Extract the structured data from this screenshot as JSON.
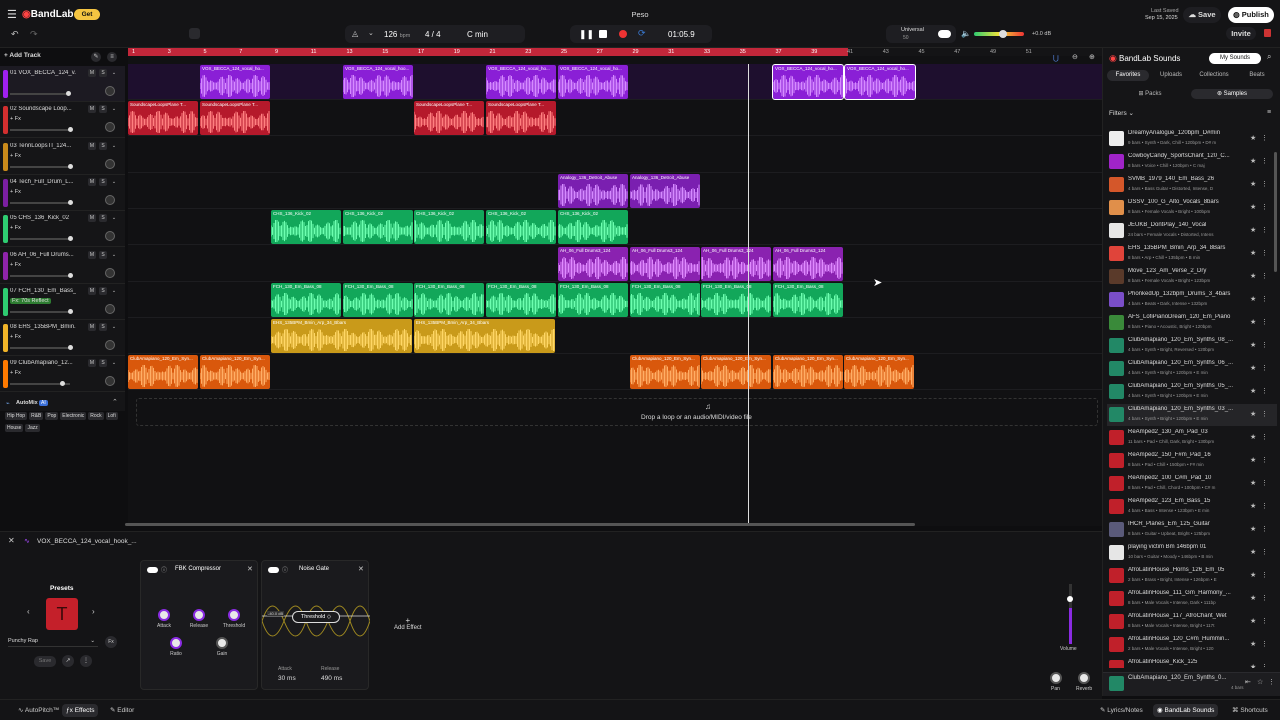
{
  "topbar": {
    "logo": "BandLab",
    "get": "Get",
    "title": "Peso",
    "bpm": "126",
    "bpm_unit": "bpm",
    "sig": "4 / 4",
    "key": "C min",
    "time": "01:05.9",
    "universal": "Universal",
    "universal_val": "50",
    "db": "+0.0 dB",
    "last_saved": "Last Saved",
    "saved_date": "Sep 15, 2025",
    "save": "Save",
    "publish": "Publish",
    "invite": "Invite",
    "add_track": "Add Track"
  },
  "tracks": [
    {
      "name": "01 VOX_BECCA_124_v...",
      "fx": "",
      "color": "#a020f0"
    },
    {
      "name": "02 Soundscape Loop...",
      "fx": "+ Fx",
      "color": "#d32f2f"
    },
    {
      "name": "03 TennLoopsTI_124...",
      "fx": "+ Fx",
      "color": "#c98a1b"
    },
    {
      "name": "04 Tech_Full_Drum_L...",
      "fx": "+ Fx",
      "color": "#7b1fa2"
    },
    {
      "name": "05 CHS_136_Kick_02",
      "fx": "+ Fx",
      "color": "#2ecc71"
    },
    {
      "name": "06 AH_06_Full Drums...",
      "fx": "+ Fx",
      "color": "#8e24aa"
    },
    {
      "name": "07 FCH_130_Em_Bass_...",
      "fx": "Fx: 70s Reflect",
      "color": "#2ecc71"
    },
    {
      "name": "08 EHS_135BPM_Bmin...",
      "fx": "+ Fx",
      "color": "#f0b429"
    },
    {
      "name": "09 ClubAmapiano_12...",
      "fx": "+ Fx",
      "color": "#ff7a00"
    }
  ],
  "ruler": [
    "1",
    "3",
    "5",
    "7",
    "9",
    "11",
    "13",
    "15",
    "17",
    "19",
    "21",
    "23",
    "25",
    "27",
    "29",
    "31",
    "33",
    "35",
    "37",
    "39",
    "41",
    "43",
    "45",
    "47",
    "49",
    "51"
  ],
  "clips": [
    {
      "lane": 0,
      "color": "#8a1fd6",
      "wave": "#d58bff",
      "labels": [
        "VOX_BECCA_124_vocal_ho...",
        "VOX_BECCA_124_vocal_hoo...",
        "VOX_BECCA_124_vocal_ho...",
        "VOX_BECCA_124_vocal_ho...",
        "VOX_BECCA_124_vocal_ho...",
        "VOX_BECCA_124_vocal_ho..."
      ],
      "starts": [
        72,
        215,
        358,
        430,
        645,
        717
      ],
      "width": 71
    },
    {
      "lane": 1,
      "color": "#b5192b",
      "wave": "#ff8080",
      "labels": [
        "SoundscapeLoopsPlane T...",
        "SoundscapeLoopsPlane T...",
        "SoundscapeLoopsPlane T...",
        "SoundscapeLoopsPlane T..."
      ],
      "starts": [
        0,
        72,
        286,
        358
      ],
      "width": 71
    },
    {
      "lane": 3,
      "color": "#7a1fb0",
      "wave": "#d58bff",
      "labels": [
        "Analogy_136_Detroit_Abuse",
        "Analogy_136_Detroit_Abuse"
      ],
      "starts": [
        430,
        502
      ],
      "width": 71
    },
    {
      "lane": 4,
      "color": "#12a75a",
      "wave": "#6dffb0",
      "labels": [
        "CHS_136_Kick_02",
        "CHS_136_Kick_02",
        "CHS_136_Kick_02",
        "CHS_136_Kick_02",
        "CHS_136_Kick_02"
      ],
      "starts": [
        143,
        215,
        286,
        358,
        430
      ],
      "width": 71
    },
    {
      "lane": 5,
      "color": "#8a22b0",
      "wave": "#e08bff",
      "labels": [
        "AH_06_Full Drums3_124",
        "AH_06_Full Drums3_124",
        "AH_06_Full Drums3_124",
        "AH_06_Full Drums3_124"
      ],
      "starts": [
        430,
        502,
        573,
        645
      ],
      "width": 71
    },
    {
      "lane": 6,
      "color": "#12a75a",
      "wave": "#6dffb0",
      "labels": [
        "FCH_130_Em_Bass_08",
        "FCH_130_Em_Bass_08",
        "FCH_130_Em_Bass_08",
        "FCH_130_Em_Bass_08",
        "FCH_130_Em_Bass_08",
        "FCH_130_Em_Bass_08",
        "FCH_130_Em_Bass_08",
        "FCH_130_Em_Bass_08"
      ],
      "starts": [
        143,
        215,
        286,
        358,
        430,
        502,
        573,
        645
      ],
      "width": 71
    },
    {
      "lane": 7,
      "color": "#c99a1a",
      "wave": "#ffd766",
      "labels": [
        "EHS_135BPM_Bmin_Arp_34_Bbars",
        "EHS_135BPM_Bmin_Arp_34_Bbars"
      ],
      "starts": [
        143,
        286
      ],
      "width": 142
    },
    {
      "lane": 8,
      "color": "#d9580c",
      "wave": "#ffae66",
      "labels": [
        "ClubAmapiano_120_Em_Syn...",
        "ClubAmapiano_120_Em_Syn...",
        "ClubAmapiano_120_Em_Syn...",
        "ClubAmapiano_120_Em_Syn...",
        "ClubAmapiano_120_Em_Syn...",
        "ClubAmapiano_120_Em_Syn..."
      ],
      "starts": [
        0,
        72,
        502,
        573,
        645,
        716
      ],
      "width": 71
    }
  ],
  "drop_text": "Drop a loop or an audio/MIDI/video file",
  "genres": {
    "title": "AutoMix",
    "badge": "AI",
    "tags": [
      "Hip Hop",
      "R&B",
      "Pop",
      "Electronic",
      "Rock",
      "Lofi",
      "House",
      "Jazz"
    ]
  },
  "sounds": {
    "title": "BandLab Sounds",
    "my_sounds": "My Sounds",
    "tabs": [
      "Favorites",
      "Uploads",
      "Collections",
      "Beats"
    ],
    "subtabs": [
      "Packs",
      "Samples"
    ],
    "filters": "Filters",
    "items": [
      {
        "name": "DreamyAnalogue_120bpm_D#min",
        "meta": "9 bars • Synth • Dark, Chill • 120bpm • D# m",
        "color": "#eee"
      },
      {
        "name": "CowboyCandy_SportsChant_120_C...",
        "meta": "8 bars • Voice • Chill • 120bpm • C maj",
        "color": "#a024c8"
      },
      {
        "name": "SVMB_1979_140_Em_Bass_26",
        "meta": "4 bars • Bass Guitar • Distorted, Intense, D",
        "color": "#d4572a"
      },
      {
        "name": "DSSV_100_G_Alto_Vocals_8bars",
        "meta": "8 bars • Female Vocals • Bright • 100bpm",
        "color": "#e08f4a"
      },
      {
        "name": "JEUKB_DontPlay_140_Vocal",
        "meta": "24 bars • Female Vocals • Distorted, Intens",
        "color": "#e6e6e6"
      },
      {
        "name": "EHS_135BPM_Bmin_Arp_34_8Bars",
        "meta": "8 bars • Arp • Chill • 135bpm • B min",
        "color": "#e0443a"
      },
      {
        "name": "Move_123_Am_Verse_2_Dry",
        "meta": "8 bars • Female Vocals • Bright • 123bpm",
        "color": "#5a3a2a"
      },
      {
        "name": "PhonkedUp_132bpm_Drums_3_4bars",
        "meta": "4 bars • Beats • Dark, Intense • 132bpm",
        "color": "#7a4ec8"
      },
      {
        "name": "AFS_LofiPianoDream_120_Em_Piano",
        "meta": "8 bars • Piano • Acoustic, Bright • 120bpm",
        "color": "#3a8a3a"
      },
      {
        "name": "ClubAmapiano_120_Em_Synths_08_...",
        "meta": "4 bars • Synth • Bright, Reversed • 120bpm",
        "color": "#228866"
      },
      {
        "name": "ClubAmapiano_120_Em_Synths_06_...",
        "meta": "4 bars • Synth • Bright • 120bpm • E min",
        "color": "#228866"
      },
      {
        "name": "ClubAmapiano_120_Em_Synths_05_...",
        "meta": "4 bars • Synth • Bright • 120bpm • E min",
        "color": "#228866"
      },
      {
        "name": "ClubAmapiano_120_Em_Synths_03_...",
        "meta": "4 bars • Synth • Bright • 120bpm • E min",
        "color": "#228866"
      },
      {
        "name": "ReAmped2_130_Am_Pad_03",
        "meta": "11 bars • Pad • Chill, Dark, Bright • 130bpm",
        "color": "#c0202a"
      },
      {
        "name": "ReAmped2_150_F#m_Pad_16",
        "meta": "8 bars • Pad • Chill • 150bpm • F# min",
        "color": "#c0202a"
      },
      {
        "name": "ReAmped2_100_C#m_Pad_10",
        "meta": "8 bars • Pad • Chill, Chord • 100bpm • C# m",
        "color": "#c0202a"
      },
      {
        "name": "ReAmped2_123_Em_Bass_15",
        "meta": "4 bars • Bass • Intense • 123bpm • E min",
        "color": "#c0202a"
      },
      {
        "name": "IHCR_Planes_Em_125_Guitar",
        "meta": "8 bars • Guitar • Upbeat, Bright • 125bpm",
        "color": "#5a5a7a"
      },
      {
        "name": "playing victim Bm 146bpm 01",
        "meta": "10 bars • Guitar • Moody • 146bpm • B min",
        "color": "#e6e6e6"
      },
      {
        "name": "AfroLatinHouse_Horns_126_Em_05",
        "meta": "2 bars • Brass • Bright, Intense • 126bpm • E",
        "color": "#c0202a"
      },
      {
        "name": "AfroLatinHouse_111_Gm_Harmony_...",
        "meta": "8 bars • Male Vocals • Intense, Dark • 111bp",
        "color": "#c0202a"
      },
      {
        "name": "AfroLatinHouse_117_AfroChant_Wet",
        "meta": "8 bars • Male Vocals • Intense, Bright • 117t",
        "color": "#c0202a"
      },
      {
        "name": "AfroLatinHouse_120_C#m_Hummin...",
        "meta": "2 bars • Male Vocals • Intense, Bright • 120",
        "color": "#c0202a"
      },
      {
        "name": "AfroLatinHouse_Kick_125",
        "meta": "",
        "color": "#c0202a"
      }
    ],
    "now_playing": {
      "name": "ClubAmapiano_120_Em_Synths_0...",
      "meta": "4 bars"
    }
  },
  "bottom": {
    "track": "VOX_BECCA_124_vocal_hook_...",
    "presets": "Presets",
    "preset_name": "Punchy Rap",
    "save": "Save",
    "fx1": {
      "title": "FBK Compressor",
      "knobs": [
        "Attack",
        "Release",
        "Threshold",
        "Ratio",
        "Gain"
      ]
    },
    "fx2": {
      "title": "Noise Gate",
      "threshold": "Threshold",
      "attack_label": "Attack",
      "attack_val": "30 ms",
      "release_label": "Release",
      "release_val": "490 ms",
      "db_label": "-40.0 dB"
    },
    "add_effect": "Add Effect",
    "volume": "Volume",
    "pan": "Pan",
    "reverb": "Reverb"
  },
  "statusbar": {
    "autopitch": "AutoPitch™",
    "effects": "Effects",
    "editor": "Editor",
    "lyrics": "Lyrics/Notes",
    "bandlab_sounds": "BandLab Sounds",
    "shortcuts": "Shortcuts"
  }
}
